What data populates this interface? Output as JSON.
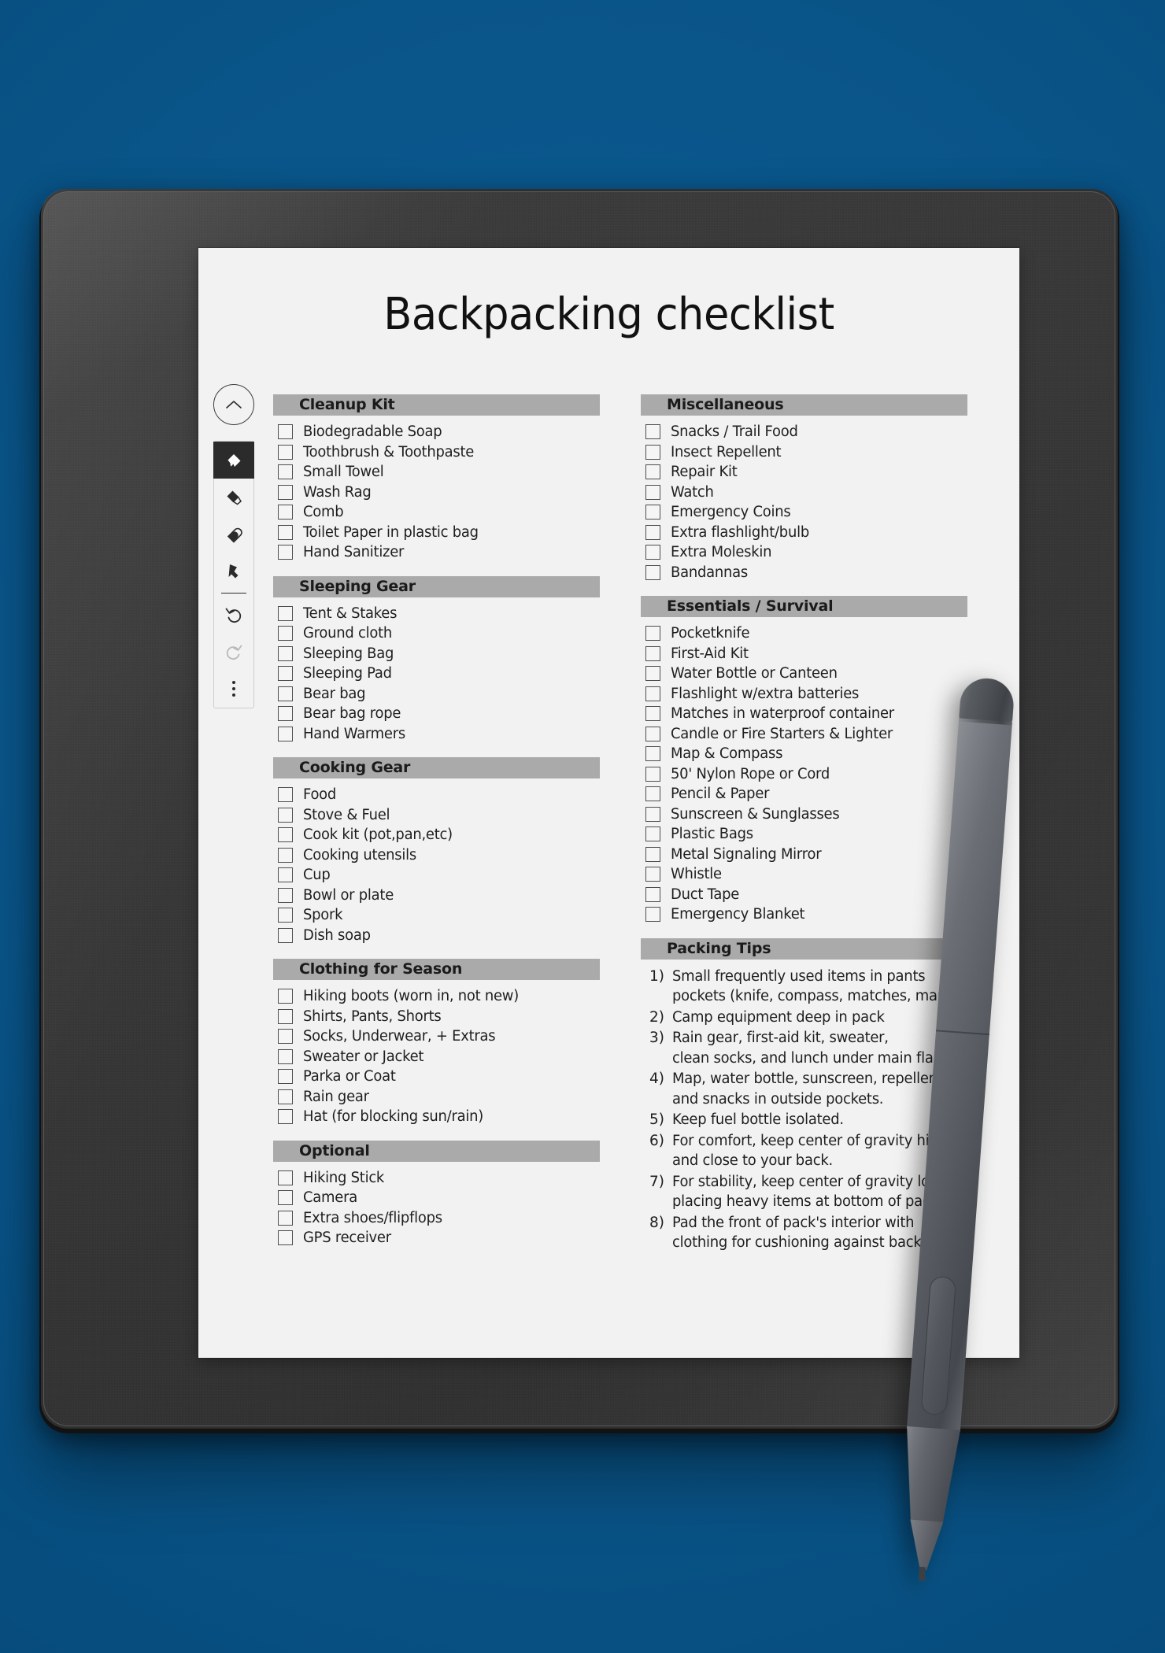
{
  "background_color": "#0a568b",
  "device": {
    "body_color": "#363636",
    "screen_bg": "#f2f2f2"
  },
  "toolbar": {
    "collapse_icon": "chevron-up-icon",
    "tools": [
      {
        "name": "pen-tool",
        "icon": "pen-icon",
        "active": true
      },
      {
        "name": "marker-tool",
        "icon": "marker-icon",
        "active": false
      },
      {
        "name": "eraser-tool",
        "icon": "eraser-icon",
        "active": false
      },
      {
        "name": "select-tool",
        "icon": "lasso-select-icon",
        "active": false
      }
    ],
    "undo_icon": "undo-icon",
    "redo_icon": "redo-icon",
    "more_icon": "more-options-icon"
  },
  "document": {
    "title": "Backpacking checklist",
    "left_column": [
      {
        "heading": "Cleanup Kit",
        "items": [
          "Biodegradable Soap",
          "Toothbrush & Toothpaste",
          "Small Towel",
          "Wash Rag",
          "Comb",
          "Toilet Paper in plastic bag",
          "Hand Sanitizer"
        ]
      },
      {
        "heading": "Sleeping Gear",
        "items": [
          "Tent & Stakes",
          "Ground cloth",
          "Sleeping Bag",
          "Sleeping Pad",
          "Bear bag",
          "Bear bag rope",
          "Hand Warmers"
        ]
      },
      {
        "heading": "Cooking Gear",
        "items": [
          "Food",
          "Stove & Fuel",
          "Cook kit (pot,pan,etc)",
          "Cooking utensils",
          "Cup",
          "Bowl or plate",
          "Spork",
          "Dish soap"
        ]
      },
      {
        "heading": "Clothing for Season",
        "items": [
          "Hiking boots (worn in, not new)",
          "Shirts, Pants, Shorts",
          "Socks, Underwear, + Extras",
          "Sweater or Jacket",
          "Parka or Coat",
          "Rain gear",
          "Hat (for blocking sun/rain)"
        ]
      },
      {
        "heading": "Optional",
        "items": [
          "Hiking Stick",
          "Camera",
          "Extra shoes/flipflops",
          "GPS receiver"
        ]
      }
    ],
    "right_column": [
      {
        "heading": "Miscellaneous",
        "items": [
          "Snacks / Trail Food",
          "Insect Repellent",
          "Repair Kit",
          "Watch",
          "Emergency Coins",
          "Extra flashlight/bulb",
          "Extra Moleskin",
          "Bandannas"
        ]
      },
      {
        "heading": "Essentials / Survival",
        "items": [
          "Pocketknife",
          "First-Aid Kit",
          "Water Bottle or Canteen",
          "Flashlight w/extra batteries",
          "Matches in waterproof container",
          "Candle or Fire Starters & Lighter",
          "Map & Compass",
          "50' Nylon Rope or Cord",
          "Pencil & Paper",
          "Sunscreen & Sunglasses",
          "Plastic Bags",
          "Metal Signaling Mirror",
          "Whistle",
          "Duct Tape",
          "Emergency Blanket"
        ]
      }
    ],
    "packing_tips": {
      "heading": "Packing Tips",
      "tips": [
        {
          "num": "1)",
          "text": "Small frequently used items in pants\npockets (knife, compass, matches, map)"
        },
        {
          "num": "2)",
          "text": "Camp equipment deep in pack"
        },
        {
          "num": "3)",
          "text": "Rain gear, first-aid kit, sweater,\nclean socks, and lunch under main flap"
        },
        {
          "num": "4)",
          "text": "Map, water bottle, sunscreen, repellent\nand snacks in outside pockets."
        },
        {
          "num": "5)",
          "text": "Keep fuel bottle isolated."
        },
        {
          "num": "6)",
          "text": "For comfort, keep center of gravity high\nand close to your back."
        },
        {
          "num": "7)",
          "text": "For stability, keep center of gravity low by\nplacing heavy items at bottom of pack."
        },
        {
          "num": "8)",
          "text": "Pad the front of pack's interior with\nclothing for cushioning against back."
        }
      ]
    }
  },
  "stylus": {
    "name": "stylus-pen",
    "body_color": "#5c6066"
  }
}
